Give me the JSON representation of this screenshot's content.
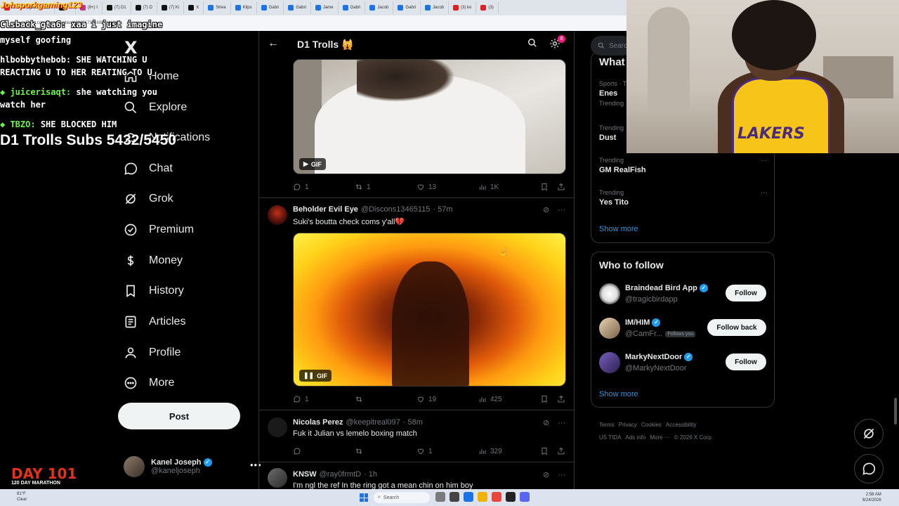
{
  "browser": {
    "tabs": [
      {
        "label": "Johsporkgaming123",
        "icon": "yt"
      },
      {
        "label": "Ni",
        "icon": "x"
      },
      {
        "label": "(8+) I",
        "icon": "ig"
      },
      {
        "label": "(7) D1",
        "icon": "x"
      },
      {
        "label": "(7) D",
        "icon": "x"
      },
      {
        "label": "(7) Ki",
        "icon": "x"
      },
      {
        "label": "X",
        "icon": "x"
      },
      {
        "label": "Strea",
        "icon": "g"
      },
      {
        "label": "Klips",
        "icon": "g"
      },
      {
        "label": "Gabri",
        "icon": "g"
      },
      {
        "label": "Gabri",
        "icon": "g"
      },
      {
        "label": "Jame",
        "icon": "g"
      },
      {
        "label": "Gabri",
        "icon": "g"
      },
      {
        "label": "Jacob",
        "icon": "g"
      },
      {
        "label": "Gabri",
        "icon": "g"
      },
      {
        "label": "Jacob",
        "icon": "g"
      },
      {
        "label": "(3) ko",
        "icon": "yt"
      },
      {
        "label": "(3)",
        "icon": "yt"
      }
    ],
    "url": "x.com/i/communities/1803517321692214104"
  },
  "stream_overlay": {
    "top_text": "Johsporkgaming123",
    "chat": [
      {
        "user": "Clsback_gta6:",
        "message": "xaa i just imagine",
        "highlight": false
      },
      {
        "user": "",
        "message": "myself goofing",
        "highlight": false
      },
      {
        "user": "hlbobbythebob:",
        "message": "SHE WATCHING U",
        "highlight": false
      },
      {
        "user": "",
        "message": "REACTING U TO HER REATING TO U",
        "highlight": false
      },
      {
        "user": "juicerisaqt:",
        "message": "she watching you",
        "highlight": true
      },
      {
        "user": "",
        "message": "watch her",
        "highlight": false
      },
      {
        "user": "TBZO:",
        "message": "SHE BLOCKED HIM",
        "highlight": true
      }
    ],
    "subs_goal": "D1 Trolls Subs 5432/5450",
    "day_badge": "DAY 101",
    "day_sub": "120 DAY MARATHON"
  },
  "sidebar": {
    "logo": "X",
    "items": [
      {
        "label": "Home",
        "icon": "home-icon"
      },
      {
        "label": "Explore",
        "icon": "search-icon"
      },
      {
        "label": "Notifications",
        "icon": "bell-icon"
      },
      {
        "label": "Chat",
        "icon": "chat-icon"
      },
      {
        "label": "Grok",
        "icon": "grok-icon"
      },
      {
        "label": "Premium",
        "icon": "premium-icon"
      },
      {
        "label": "Money",
        "icon": "money-icon"
      },
      {
        "label": "History",
        "icon": "bookmark-icon"
      },
      {
        "label": "Articles",
        "icon": "articles-icon"
      },
      {
        "label": "Profile",
        "icon": "person-icon"
      },
      {
        "label": "More",
        "icon": "more-circle-icon"
      }
    ],
    "post_label": "Post",
    "account": {
      "name": "Kanel Joseph",
      "handle": "@kaneljoseph"
    }
  },
  "main": {
    "title": "D1 Trolls 🙀",
    "notif_count": "8",
    "tweets": [
      {
        "name": "",
        "handle": "",
        "time": "",
        "text": "",
        "media_tag": "GIF",
        "stats": {
          "replies": "1",
          "reposts": "1",
          "likes": "13",
          "views": "1K"
        }
      },
      {
        "name": "Beholder Evil Eye",
        "handle": "@Discons13465115",
        "time": "· 57m",
        "text": "Suki's boutta check coms y'all💔",
        "media_tag": "GIF",
        "stats": {
          "replies": "1",
          "reposts": "",
          "likes": "19",
          "views": "425"
        }
      },
      {
        "name": "Nicolas Perez",
        "handle": "@keepitreal097",
        "time": "· 58m",
        "text": "Fuk it Julian vs lemelo boxing match",
        "media_tag": "",
        "stats": {
          "replies": "",
          "reposts": "",
          "likes": "1",
          "views": "329"
        }
      },
      {
        "name": "KNSW",
        "handle": "@ray0frmtD",
        "time": "· 1h",
        "text": "I'm ngl the ref In the ring got a mean chin on him boy",
        "media_tag": "",
        "stats": {
          "replies": "",
          "reposts": "",
          "likes": "",
          "views": ""
        }
      }
    ]
  },
  "right": {
    "search_placeholder": "Search",
    "trends_title": "What",
    "trends": [
      {
        "category": "Sports · Trending",
        "name": "Enes",
        "sub": "Trending"
      },
      {
        "category": "Trending",
        "name": "Dust",
        "sub": ""
      },
      {
        "category": "Trending",
        "name": "GM RealFish",
        "sub": ""
      },
      {
        "category": "Trending",
        "name": "Yes Tito",
        "sub": ""
      }
    ],
    "show_more": "Show more",
    "wtf_title": "Who to follow",
    "follow": [
      {
        "name": "Braindead Bird App",
        "handle": "@tragicbirdapp",
        "button": "Follow",
        "follows_you": ""
      },
      {
        "name": "IM/HIM",
        "handle": "@CamFr...",
        "button": "Follow back",
        "follows_you": "Follows you"
      },
      {
        "name": "MarkyNextDoor",
        "handle": "@MarkyNextDoor",
        "button": "Follow",
        "follows_you": ""
      }
    ],
    "wtf_show_more": "Show more",
    "footer_line1": [
      "Terms",
      "Privacy",
      "Cookies",
      "Accessibility"
    ],
    "footer_line2": [
      "US TIDA",
      "Ads info",
      "More ···",
      "© 2026 X Corp."
    ]
  },
  "taskbar": {
    "weather_temp": "81°F",
    "weather_desc": "Clear",
    "search": "Search",
    "time": "2:58 AM",
    "date": "8/24/2026"
  },
  "colors": {
    "accent": "#1d9bf0",
    "background": "#000000",
    "border": "#2f3336",
    "muted": "#71767b"
  }
}
